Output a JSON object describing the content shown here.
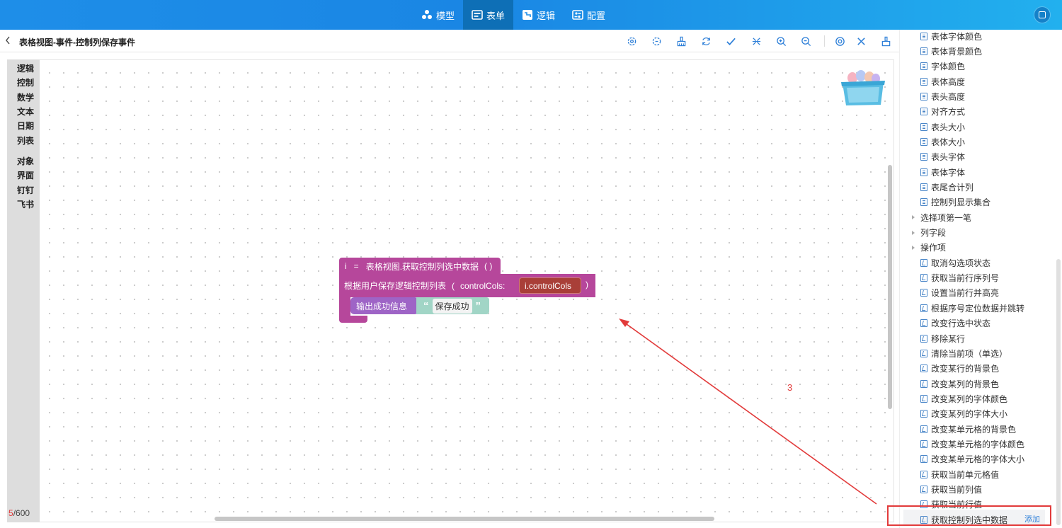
{
  "nav": {
    "tabs": [
      {
        "label": "模型",
        "icon": "model-icon"
      },
      {
        "label": "表单",
        "icon": "form-icon",
        "active": true
      },
      {
        "label": "逻辑",
        "icon": "logic-icon"
      },
      {
        "label": "配置",
        "icon": "config-icon"
      }
    ],
    "accent": "#1e8ee8",
    "active_bg": "#0e6fb6"
  },
  "header": {
    "title": "表格视图-事件-控制列保存事件",
    "toolbar_icons": [
      "settings-gear-icon",
      "settings-gear-alt-icon",
      "clean-brush-icon",
      "refresh-icon",
      "check-icon",
      "collapse-icon",
      "zoom-in-icon",
      "zoom-out-icon",
      "target-icon",
      "close-icon",
      "brush-icon"
    ]
  },
  "categories": [
    "逻辑",
    "控制",
    "数学",
    "文本",
    "日期",
    "列表",
    "对象",
    "界面",
    "钉钉",
    "飞书"
  ],
  "counter": {
    "current": "5",
    "total": "/600"
  },
  "blocks": {
    "assign": {
      "var": "i",
      "eq": "=",
      "call": "表格视图.获取控制列选中数据",
      "paren": "(   )"
    },
    "save": {
      "call": "根据用户保存逻辑控制列表",
      "open": "(",
      "param": "controlCols:",
      "arg": "i.controlCols",
      "close": ")"
    },
    "output": {
      "call": "输出成功信息",
      "lq": "“",
      "value": "保存成功",
      "rq": "”"
    }
  },
  "annotation": {
    "number": "3",
    "color": "#e23b3b"
  },
  "panel": {
    "props": [
      "表体字体颜色",
      "表体背景颜色",
      "字体颜色",
      "表体高度",
      "表头高度",
      "对齐方式",
      "表头大小",
      "表体大小",
      "表头字体",
      "表体字体",
      "表尾合计列",
      "控制列显示集合"
    ],
    "groups": [
      "选择项第一笔",
      "列字段",
      "操作项"
    ],
    "methods": [
      "取消勾选项状态",
      "获取当前行序列号",
      "设置当前行并高亮",
      "根据序号定位数据并跳转",
      "改变行选中状态",
      "移除某行",
      "清除当前项（单选）",
      "改变某行的背景色",
      "改变某列的背景色",
      "改变某列的字体颜色",
      "改变某列的字体大小",
      "改变某单元格的背景色",
      "改变某单元格的字体颜色",
      "改变某单元格的字体大小",
      "获取当前单元格值",
      "获取当前列值",
      "获取当前行值",
      "获取控制列选中数据"
    ],
    "add_label": "添加"
  }
}
